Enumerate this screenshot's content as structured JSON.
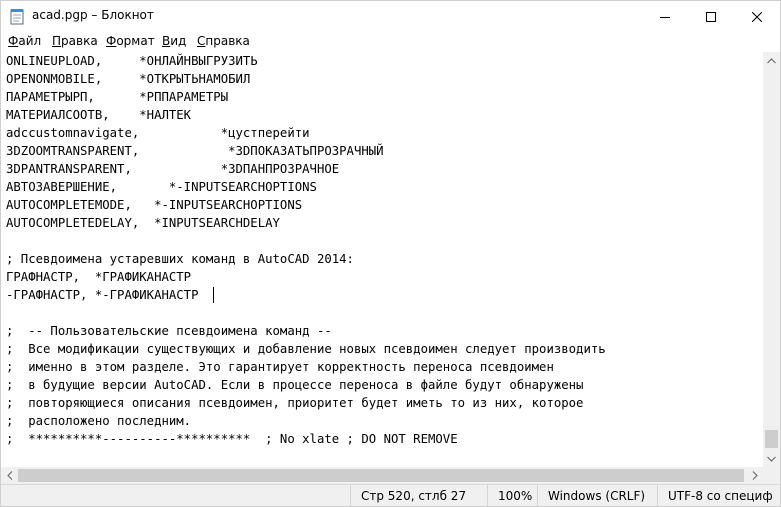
{
  "window": {
    "title": "acad.pgp – Блокнот"
  },
  "menu": [
    "Файл",
    "Правка",
    "Формат",
    "Вид",
    "Справка"
  ],
  "editor": {
    "lines": [
      "ONLINEUPLOAD,     *ОНЛАЙНВЫГРУЗИТЬ",
      "OPENONMOBILE,     *ОТКРЫТЬНАМОБИЛ",
      "ПАРАМЕТРЫРП,      *РППАРАМЕТРЫ",
      "МАТЕРИАЛСООТВ,    *НАЛТЕК",
      "adccustomnavigate,           *цустперейти",
      "3DZOOMTRANSPARENT,            *3DПОКАЗАТЬПРОЗРАЧНЫЙ",
      "3DPANTRANSPARENT,            *3DПАНПРОЗРАЧНОЕ",
      "АВТОЗАВЕРШЕНИЕ,       *-INPUTSEARCHOPTIONS",
      "AUTOCOMPLETEMODE,   *-INPUTSEARCHOPTIONS",
      "AUTOCOMPLETEDELAY,  *INPUTSEARCHDELAY",
      "",
      "; Псевдоимена устаревших команд в AutoCAD 2014:",
      "ГРАФНАСТР,  *ГРАФИКАНАСТР",
      "-ГРАФНАСТР, *-ГРАФИКАНАСТР",
      "",
      ";  -- Пользовательские псевдоимена команд --",
      ";  Все модификации существующих и добавление новых псевдоимен следует производить",
      ";  именно в этом разделе. Это гарантирует корректность переноса псевдоимен",
      ";  в будущие версии AutoCAD. Если в процессе переноса в файле будут обнаружены",
      ";  повторяющиеся описания псевдоимен, приоритет будет иметь то из них, которое",
      ";  расположено последним.",
      ";  **********----------**********  ; No xlate ; DO NOT REMOVE"
    ]
  },
  "status": {
    "position": "Стр 520, стлб 27",
    "zoom": "100%",
    "line_ending": "Windows (CRLF)",
    "encoding": "UTF-8 со специф"
  }
}
